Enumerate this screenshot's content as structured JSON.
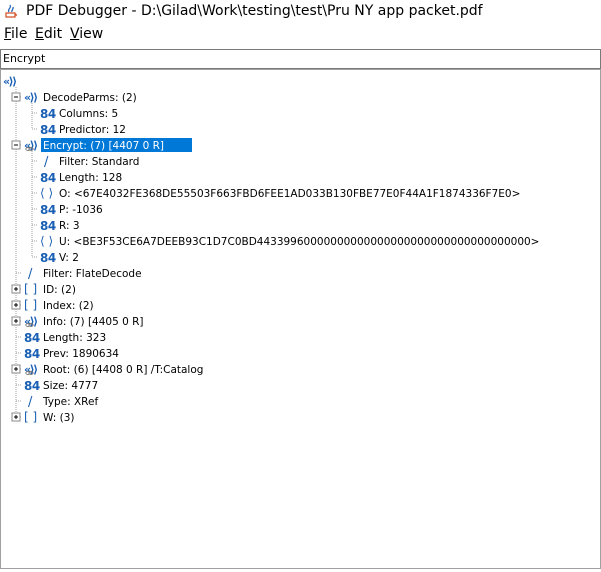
{
  "window": {
    "title": "PDF Debugger - D:\\Gilad\\Work\\testing\\test\\Pru NY app packet.pdf"
  },
  "menu": [
    {
      "mnemonic": "F",
      "rest": "ile"
    },
    {
      "mnemonic": "E",
      "rest": "dit"
    },
    {
      "mnemonic": "V",
      "rest": "iew"
    }
  ],
  "path_field": {
    "value": "Encrypt"
  },
  "icons": {
    "dict": "dictionary-icon",
    "number": "number-icon",
    "name": "name-icon",
    "string": "string-icon",
    "array": "array-icon"
  },
  "colors": {
    "icon_blue": "#1a5fb4",
    "selection": "#0078d7"
  },
  "tree": [
    {
      "depth": 0,
      "icon": "dict",
      "text": "",
      "root": true
    },
    {
      "depth": 1,
      "icon": "dict",
      "text": "DecodeParms:  (2)",
      "toggle": "-"
    },
    {
      "depth": 2,
      "icon": "number",
      "text": "Columns:  5"
    },
    {
      "depth": 2,
      "icon": "number",
      "text": "Predictor:  12"
    },
    {
      "depth": 1,
      "icon": "dict",
      "text": "Encrypt:  (7) [4407 0 R]",
      "toggle": "-",
      "selected": true,
      "ref": true
    },
    {
      "depth": 2,
      "icon": "name",
      "text": "Filter:  Standard"
    },
    {
      "depth": 2,
      "icon": "number",
      "text": "Length:  128"
    },
    {
      "depth": 2,
      "icon": "string",
      "text": "O:  <67E4032FE368DE55503F663FBD6FEE1AD033B130FBE77E0F44A1F1874336F7E0>"
    },
    {
      "depth": 2,
      "icon": "number",
      "text": "P:  -1036"
    },
    {
      "depth": 2,
      "icon": "number",
      "text": "R:  3"
    },
    {
      "depth": 2,
      "icon": "string",
      "text": "U:  <BE3F53CE6A7DEEB93C1D7C0BD44339960000000000000000000000000000000000>"
    },
    {
      "depth": 2,
      "icon": "number",
      "text": "V:  2"
    },
    {
      "depth": 1,
      "icon": "name",
      "text": "Filter:  FlateDecode"
    },
    {
      "depth": 1,
      "icon": "array",
      "text": "ID:  (2)",
      "toggle": "+"
    },
    {
      "depth": 1,
      "icon": "array",
      "text": "Index:  (2)",
      "toggle": "+"
    },
    {
      "depth": 1,
      "icon": "dict",
      "text": "Info:  (7) [4405 0 R]",
      "toggle": "+",
      "ref": true
    },
    {
      "depth": 1,
      "icon": "number",
      "text": "Length:  323"
    },
    {
      "depth": 1,
      "icon": "number",
      "text": "Prev:  1890634"
    },
    {
      "depth": 1,
      "icon": "dict",
      "text": "Root:  (6) [4408 0 R]   /T:Catalog",
      "toggle": "+",
      "ref": true
    },
    {
      "depth": 1,
      "icon": "number",
      "text": "Size:  4777"
    },
    {
      "depth": 1,
      "icon": "name",
      "text": "Type:  XRef"
    },
    {
      "depth": 1,
      "icon": "array",
      "text": "W:  (3)",
      "toggle": "+"
    }
  ]
}
